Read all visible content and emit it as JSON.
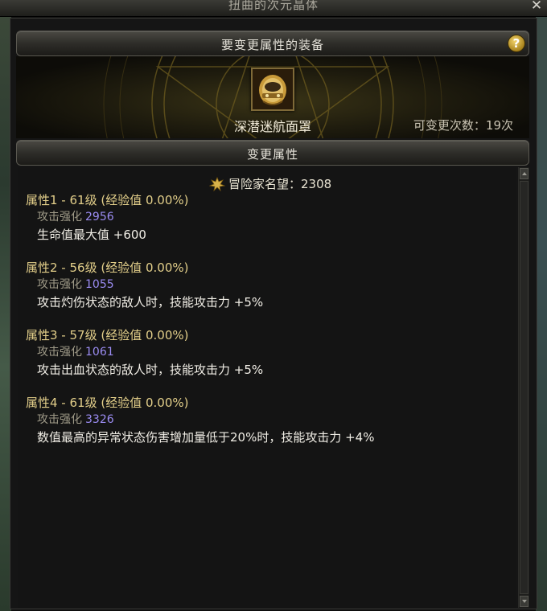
{
  "window": {
    "title": "扭曲的次元晶体"
  },
  "equip_section": {
    "header": "要变更属性的装备",
    "item_name": "深潜迷航面罩",
    "change_count": "可变更次数：19次"
  },
  "change_section": {
    "header": "变更属性",
    "fame": "冒险家名望：2308",
    "attributes": [
      {
        "title": "属性1 - 61级 (经验值 0.00%)",
        "sub_label": "攻击强化",
        "sub_value": "2956",
        "effect": "生命值最大值 +600"
      },
      {
        "title": "属性2 - 56级 (经验值 0.00%)",
        "sub_label": "攻击强化",
        "sub_value": "1055",
        "effect": "攻击灼伤状态的敌人时，技能攻击力 +5%"
      },
      {
        "title": "属性3 - 57级 (经验值 0.00%)",
        "sub_label": "攻击强化",
        "sub_value": "1061",
        "effect": "攻击出血状态的敌人时，技能攻击力 +5%"
      },
      {
        "title": "属性4 - 61级 (经验值 0.00%)",
        "sub_label": "攻击强化",
        "sub_value": "3326",
        "effect": "数值最高的异常状态伤害增加量低于20%时，技能攻击力 +4%"
      }
    ]
  },
  "icons": {
    "close": "close-icon",
    "help": "help-icon",
    "fame": "fame-icon",
    "item": "mask-icon"
  },
  "colors": {
    "attr_title": "#e3cf8a",
    "attr_value": "#9b8cf2",
    "text": "#f1eee6",
    "accent_gold": "#b8961f"
  }
}
